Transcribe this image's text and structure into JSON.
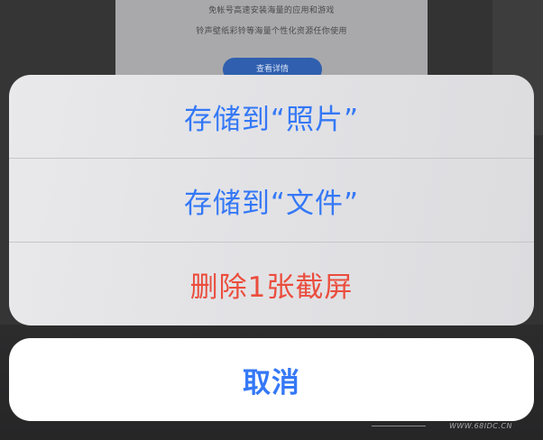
{
  "background": {
    "card_line_1": "免帐号高速安装海量的应用和游戏",
    "card_line_2": "铃声壁纸彩铃等海量个性化资源任你使用",
    "card_button": "查看详情"
  },
  "action_sheet": {
    "actions": [
      {
        "label": "存储到“照片”",
        "color": "#3478f6"
      },
      {
        "label": "存储到“文件”",
        "color": "#3478f6"
      },
      {
        "label": "删除1张截屏",
        "color": "#eb4d3d"
      }
    ],
    "cancel_label": "取消"
  },
  "watermark": "WWW.68IDC.CN",
  "colors": {
    "accent": "#3478f6",
    "destructive": "#eb4d3d"
  }
}
